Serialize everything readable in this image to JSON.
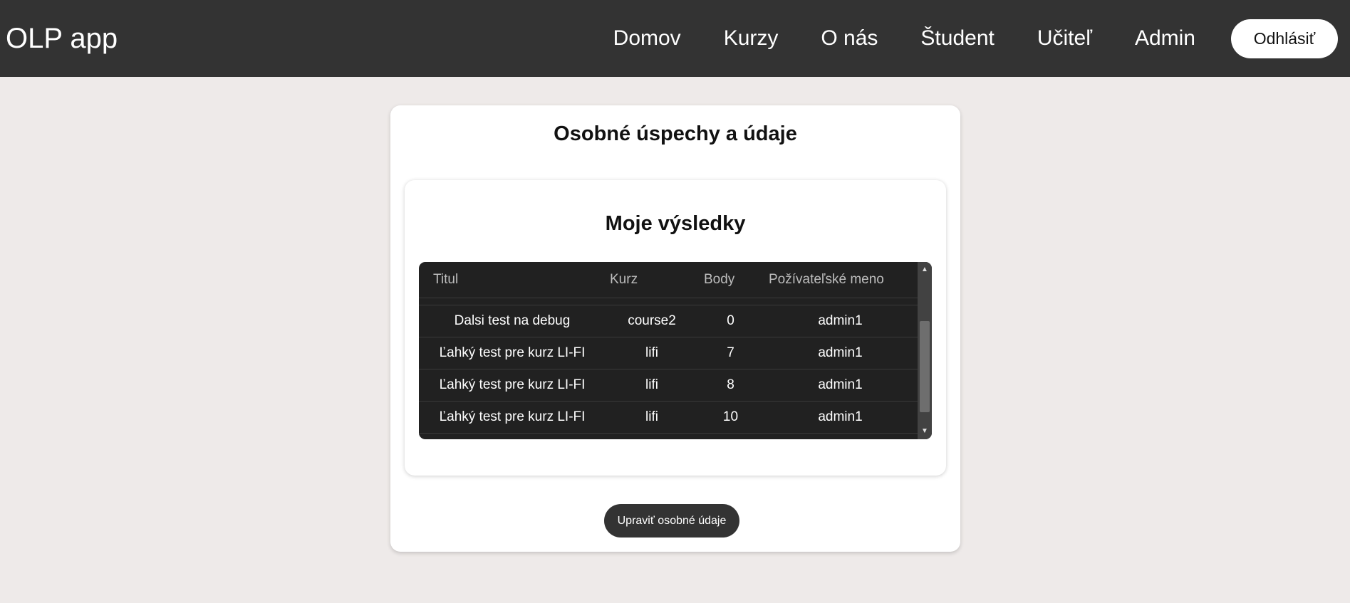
{
  "app": {
    "brand": "OLP app"
  },
  "nav": {
    "items": [
      {
        "label": "Domov"
      },
      {
        "label": "Kurzy"
      },
      {
        "label": "O nás"
      },
      {
        "label": "Študent"
      },
      {
        "label": "Učiteľ"
      },
      {
        "label": "Admin"
      }
    ],
    "logout_label": "Odhlásiť"
  },
  "page": {
    "title": "Osobné úspechy a údaje",
    "edit_button_label": "Upraviť osobné údaje"
  },
  "results": {
    "title": "Moje výsledky",
    "columns": [
      "Titul",
      "Kurz",
      "Body",
      "Požívateľské meno"
    ],
    "rows": [
      [
        "Dalsi test na debug",
        "course2",
        "0",
        "admin1"
      ],
      [
        "Ľahký test pre kurz LI-FI",
        "lifi",
        "7",
        "admin1"
      ],
      [
        "Ľahký test pre kurz LI-FI",
        "lifi",
        "8",
        "admin1"
      ],
      [
        "Ľahký test pre kurz LI-FI",
        "lifi",
        "10",
        "admin1"
      ]
    ]
  },
  "colors": {
    "navbar_bg": "#333333",
    "page_bg": "#eeeae9",
    "table_bg": "#212121",
    "button_dark": "#333333"
  },
  "icons": {
    "scroll_up": "scroll-up-arrow-icon",
    "scroll_down": "scroll-down-arrow-icon"
  }
}
